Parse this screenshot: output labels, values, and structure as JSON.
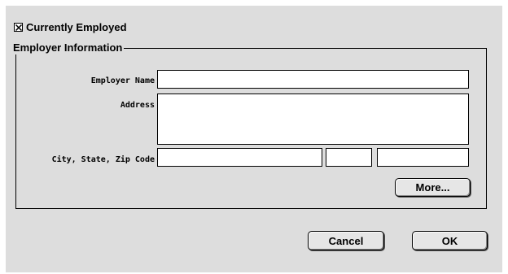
{
  "currently_employed": {
    "label": "Currently Employed",
    "checked": true,
    "icon": "checkbox-x-icon"
  },
  "employer_group": {
    "title": "Employer Information",
    "fields": {
      "employer_name": {
        "label": "Employer Name",
        "value": ""
      },
      "address": {
        "label": "Address",
        "value": ""
      },
      "city_state_zip": {
        "label": "City, State, Zip Code",
        "city": "",
        "state": "",
        "zip": ""
      }
    },
    "more_label": "More..."
  },
  "buttons": {
    "cancel_label": "Cancel",
    "ok_label": "OK"
  }
}
